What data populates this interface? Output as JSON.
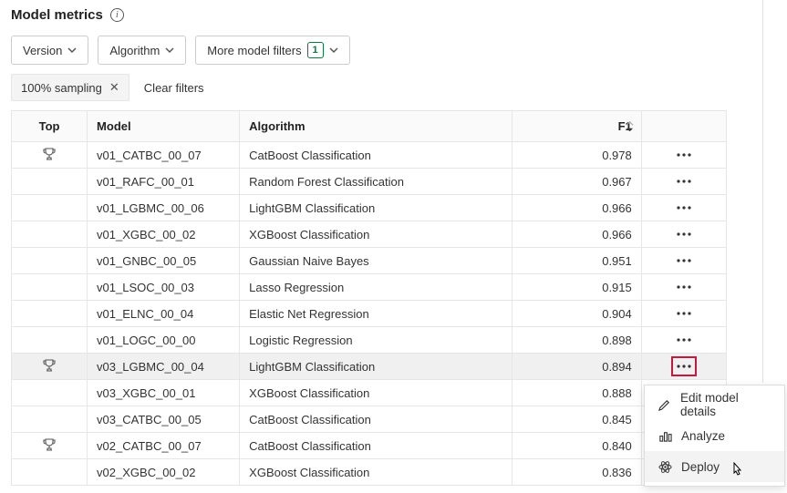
{
  "header": {
    "title": "Model metrics"
  },
  "filters": {
    "version_label": "Version",
    "algorithm_label": "Algorithm",
    "more_label": "More model filters",
    "more_count": "1"
  },
  "chips": {
    "sampling_label": "100% sampling",
    "clear_label": "Clear filters"
  },
  "columns": {
    "top": "Top",
    "model": "Model",
    "algorithm": "Algorithm",
    "f1": "F1"
  },
  "rows": [
    {
      "top": true,
      "model": "v01_CATBC_00_07",
      "algorithm": "CatBoost Classification",
      "f1": "0.978"
    },
    {
      "top": false,
      "model": "v01_RAFC_00_01",
      "algorithm": "Random Forest Classification",
      "f1": "0.967"
    },
    {
      "top": false,
      "model": "v01_LGBMC_00_06",
      "algorithm": "LightGBM Classification",
      "f1": "0.966"
    },
    {
      "top": false,
      "model": "v01_XGBC_00_02",
      "algorithm": "XGBoost Classification",
      "f1": "0.966"
    },
    {
      "top": false,
      "model": "v01_GNBC_00_05",
      "algorithm": "Gaussian Naive Bayes",
      "f1": "0.951"
    },
    {
      "top": false,
      "model": "v01_LSOC_00_03",
      "algorithm": "Lasso Regression",
      "f1": "0.915"
    },
    {
      "top": false,
      "model": "v01_ELNC_00_04",
      "algorithm": "Elastic Net Regression",
      "f1": "0.904"
    },
    {
      "top": false,
      "model": "v01_LOGC_00_00",
      "algorithm": "Logistic Regression",
      "f1": "0.898"
    },
    {
      "top": true,
      "model": "v03_LGBMC_00_04",
      "algorithm": "LightGBM Classification",
      "f1": "0.894",
      "highlight": true
    },
    {
      "top": false,
      "model": "v03_XGBC_00_01",
      "algorithm": "XGBoost Classification",
      "f1": "0.888"
    },
    {
      "top": false,
      "model": "v03_CATBC_00_05",
      "algorithm": "CatBoost Classification",
      "f1": "0.845"
    },
    {
      "top": true,
      "model": "v02_CATBC_00_07",
      "algorithm": "CatBoost Classification",
      "f1": "0.840"
    },
    {
      "top": false,
      "model": "v02_XGBC_00_02",
      "algorithm": "XGBoost Classification",
      "f1": "0.836"
    }
  ],
  "menu": {
    "edit": "Edit model details",
    "analyze": "Analyze",
    "deploy": "Deploy"
  }
}
